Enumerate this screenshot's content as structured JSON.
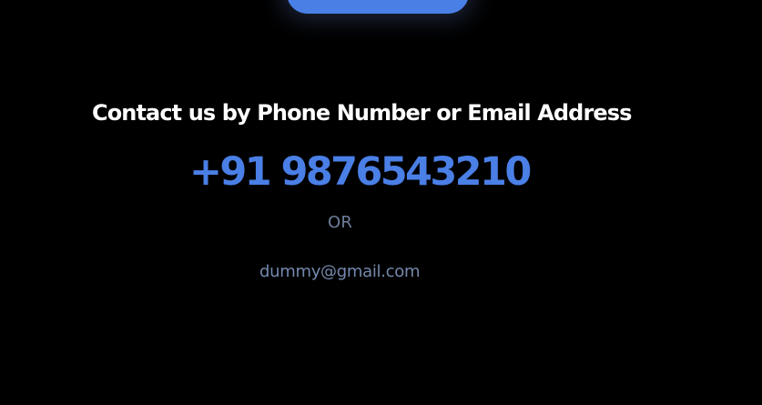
{
  "contact": {
    "heading": "Contact us by Phone Number or Email Address",
    "phone": "+91 9876543210",
    "separator": "OR",
    "email": "dummy@gmail.com"
  },
  "colors": {
    "background": "#000000",
    "accent": "#4a7fe6",
    "heading_text": "#ffffff",
    "muted_text": "#6e7d99"
  }
}
